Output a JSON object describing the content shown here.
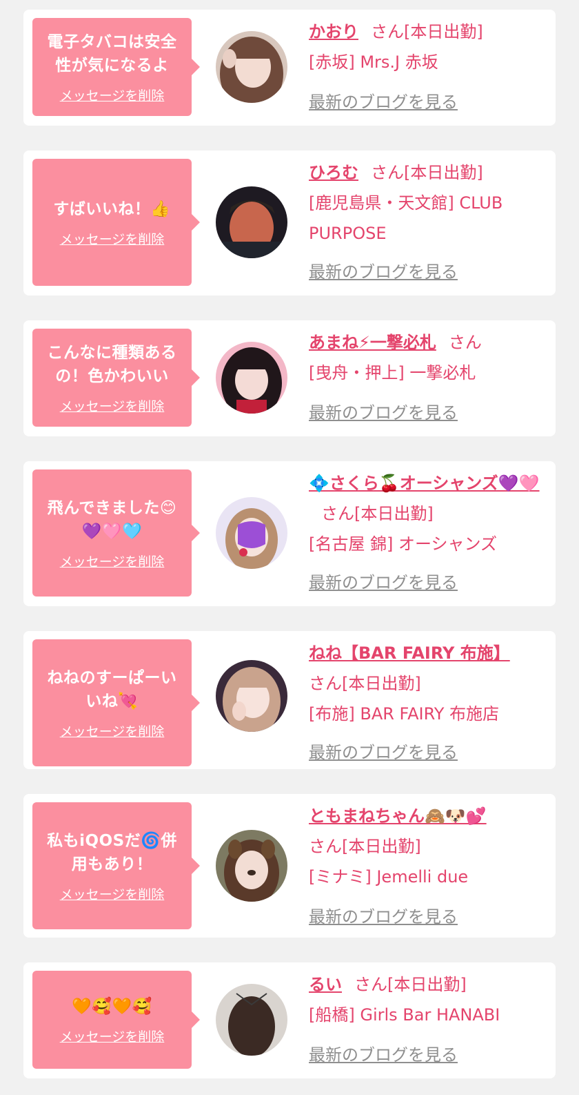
{
  "colors": {
    "accent": "#e4446c",
    "bubble": "#fb8f9f",
    "link_gray": "#8f8f8f",
    "background": "#f1f1f1"
  },
  "delete_label": "メッセージを削除",
  "blog_label": "最新のブログを見る",
  "san_label": "さん",
  "attendance_label": "[本日出勤]",
  "cards": [
    {
      "message": "電子タバコは安全性が気になるよ",
      "name": "かおり",
      "shop": "[赤坂] Mrs.J 赤坂",
      "avatar": "woman-long-brown-hair"
    },
    {
      "message": "すばいいね！👍",
      "name": "ひろむ",
      "shop": "[鹿児島県・天文館] CLUB PURPOSE",
      "avatar": "man-dark-background"
    },
    {
      "message": "こんなに種類あるの！色かわいい",
      "name": "あまね⚡一撃必札",
      "shop": "[曳舟・押上] 一撃必札",
      "avatar": "woman-black-hair-pink"
    },
    {
      "message": "飛んできました😊💜🩷🩵",
      "name": "💠さくら🍒オーシャンズ💜🩷",
      "shop": "[名古屋 錦] オーシャンズ",
      "avatar": "woman-heart-sticker"
    },
    {
      "message": "ねねのすーぱーいいね💘",
      "name": "ねね【BAR FAIRY 布施】",
      "shop": "[布施] BAR FAIRY 布施店",
      "avatar": "woman-hand-on-face"
    },
    {
      "message": "私もiQOSだ🌀併用もあり！",
      "name": "ともまねちゃん🙈🐶💕",
      "shop": "[ミナミ] Jemelli due",
      "avatar": "woman-dog-filter"
    },
    {
      "message": "🧡🥰🧡🥰",
      "name": "るい",
      "shop": "[船橋] Girls Bar HANABI",
      "avatar": "back-of-head-dark-hair"
    }
  ]
}
